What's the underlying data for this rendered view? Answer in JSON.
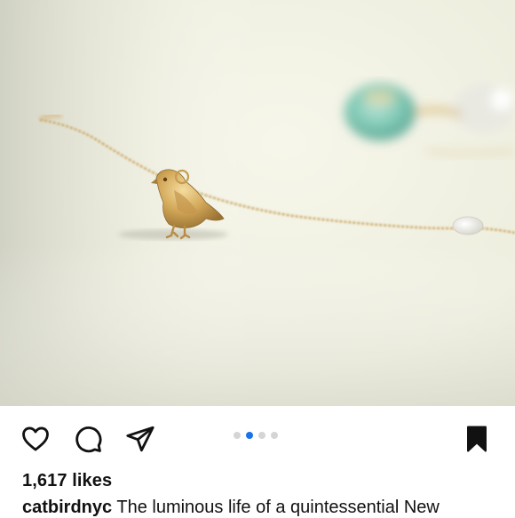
{
  "post": {
    "image_alt": "gold bird charm on a delicate chain bracelet with pearl and amazonite stones",
    "carousel": {
      "count": 4,
      "active_index": 1
    },
    "actions": {
      "like_icon": "heart-outline-icon",
      "comment_icon": "comment-bubble-icon",
      "share_icon": "paper-plane-icon",
      "save_icon": "bookmark-filled-icon"
    },
    "likes_text": "1,617 likes",
    "caption": {
      "username": "catbirdnyc",
      "text": " The luminous life of a quintessential New"
    }
  },
  "colors": {
    "accent_dot": "#1a73e8",
    "inactive_dot": "#d5d5d5",
    "icon": "#111111"
  }
}
